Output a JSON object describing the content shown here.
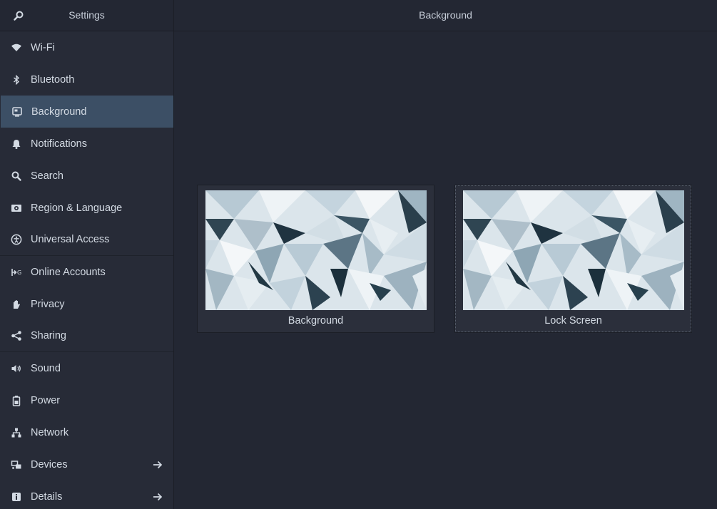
{
  "header": {
    "app_title": "Settings",
    "page_title": "Background"
  },
  "sidebar": {
    "items": [
      {
        "label": "Wi-Fi",
        "icon": "wifi-icon"
      },
      {
        "label": "Bluetooth",
        "icon": "bluetooth-icon"
      },
      {
        "label": "Background",
        "icon": "background-icon",
        "active": true
      },
      {
        "label": "Notifications",
        "icon": "bell-icon"
      },
      {
        "label": "Search",
        "icon": "search-icon"
      },
      {
        "label": "Region & Language",
        "icon": "region-icon"
      },
      {
        "label": "Universal Access",
        "icon": "accessibility-icon"
      },
      {
        "label": "Online Accounts",
        "icon": "online-accounts-icon"
      },
      {
        "label": "Privacy",
        "icon": "hand-icon"
      },
      {
        "label": "Sharing",
        "icon": "share-icon"
      },
      {
        "label": "Sound",
        "icon": "speaker-icon"
      },
      {
        "label": "Power",
        "icon": "battery-icon"
      },
      {
        "label": "Network",
        "icon": "network-icon"
      },
      {
        "label": "Devices",
        "icon": "devices-icon",
        "has_submenu": true
      },
      {
        "label": "Details",
        "icon": "info-icon",
        "has_submenu": true
      }
    ]
  },
  "main": {
    "cards": [
      {
        "label": "Background"
      },
      {
        "label": "Lock Screen"
      }
    ]
  },
  "colors": {
    "window_bg": "#232733",
    "sidebar_bg": "#272b37",
    "active_item": "#3c4f65",
    "text": "#d3dae3"
  }
}
